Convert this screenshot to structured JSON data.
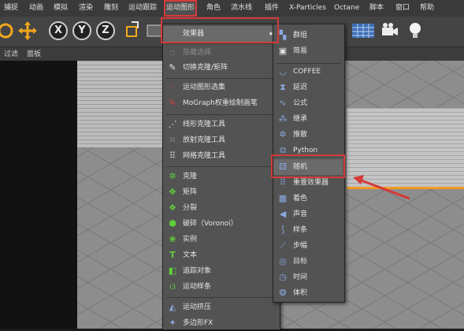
{
  "menubar": [
    "捕捉",
    "动画",
    "模拟",
    "渲染",
    "雕刻",
    "运动跟踪",
    "运动图形",
    "角色",
    "流水线",
    "插件",
    "X-Particles",
    "Octane",
    "脚本",
    "窗口",
    "帮助"
  ],
  "active_menu": "运动图形",
  "toolbar": {
    "axis_x": "X",
    "axis_y": "Y",
    "axis_z": "Z"
  },
  "subbar": [
    "过滤",
    "面板"
  ],
  "mograph_menu": {
    "effector_submenu_label": "效果器",
    "items_group1": [
      "隐藏选择",
      "切换克隆/矩阵"
    ],
    "items_group2": [
      "运动图形选集",
      "MoGraph权重绘制画笔"
    ],
    "items_group3": [
      "线形克隆工具",
      "放射克隆工具",
      "网格克隆工具"
    ],
    "items_group4": [
      "克隆",
      "矩阵",
      "分裂",
      "破碎（Voronoi）",
      "实例",
      "文本",
      "追踪对象",
      "运动样条"
    ],
    "items_group5": [
      "运动挤压",
      "多边形FX"
    ]
  },
  "effector_menu": {
    "items_top": [
      "群组",
      "简易"
    ],
    "items": [
      "COFFEE",
      "延迟",
      "公式",
      "继承",
      "推散",
      "Python",
      "随机",
      "重置效果器",
      "着色",
      "声音",
      "样条",
      "步幅",
      "目标",
      "时间",
      "体积"
    ],
    "highlighted": "随机"
  },
  "colors": {
    "annotation_red": "#d43a3a",
    "menu_bg": "#535353",
    "accent_orange": "#f29b21"
  }
}
